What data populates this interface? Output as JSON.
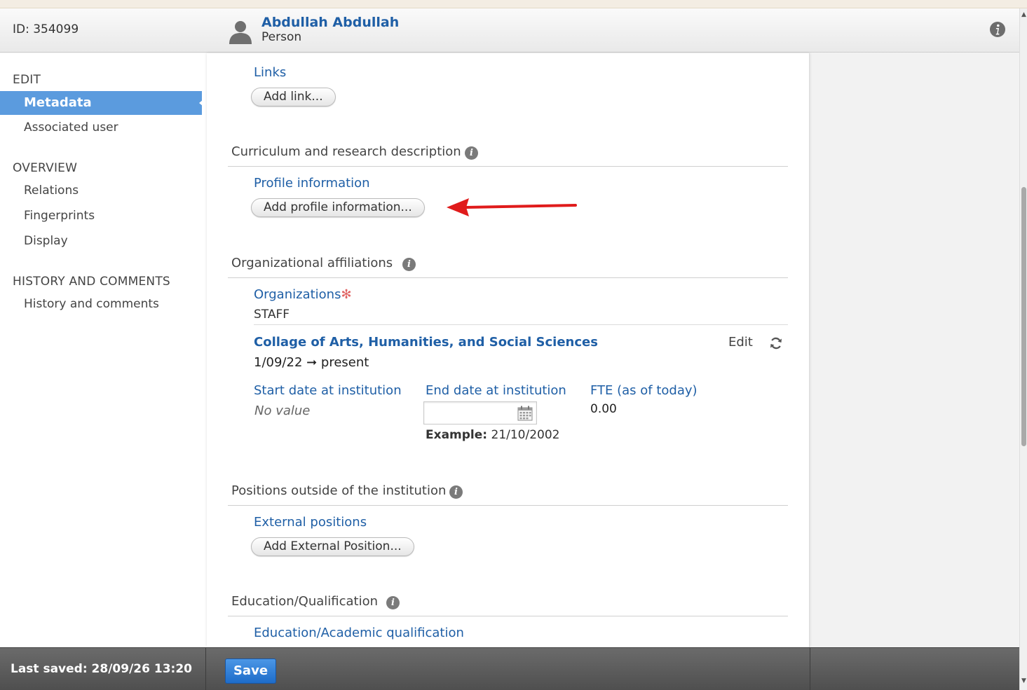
{
  "header": {
    "id_text": "ID: 354099",
    "person_name": "Abdullah Abdullah",
    "person_type": "Person"
  },
  "sidebar": {
    "edit_heading": "EDIT",
    "metadata": "Metadata",
    "associated_user": "Associated user",
    "overview_heading": "OVERVIEW",
    "relations": "Relations",
    "fingerprints": "Fingerprints",
    "display": "Display",
    "history_heading": "HISTORY AND COMMENTS",
    "history_item": "History and comments"
  },
  "main": {
    "links_label": "Links",
    "add_link": "Add link...",
    "curriculum_title": "Curriculum and research description",
    "profile_label": "Profile information",
    "add_profile": "Add profile information...",
    "org_affiliations_title": "Organizational affiliations",
    "organizations_label": "Organizations",
    "required_mark": "✻",
    "staff_label": "STAFF",
    "org_name": "Collage of Arts,  Humanities, and Social Sciences",
    "org_edit": "Edit",
    "org_period": "1/09/22 ➞ present",
    "start_date_label": "Start date at institution",
    "start_date_value": "No value",
    "end_date_label": "End date at institution",
    "end_date_value": "",
    "example_label": "Example:",
    "example_value": "21/10/2002",
    "fte_label": "FTE (as of today)",
    "fte_value": "0.00",
    "positions_title": "Positions outside of the institution",
    "external_positions_label": "External positions",
    "add_external": "Add External Position...",
    "education_title": "Education/Qualification",
    "education_label": "Education/Academic qualification"
  },
  "footer": {
    "last_saved": "Last saved: 28/09/26 13:20",
    "save": "Save"
  },
  "icons": {
    "avatar": "person-silhouette-icon",
    "info": "info-icon",
    "calendar": "calendar-icon",
    "refresh": "refresh-icon",
    "annotation": "red-arrow-annotation"
  },
  "colors": {
    "accent_blue": "#1f5fa6",
    "active_nav": "#5b9bde",
    "save_button": "#1e6cc9",
    "annotation_red": "#e01b1b"
  }
}
